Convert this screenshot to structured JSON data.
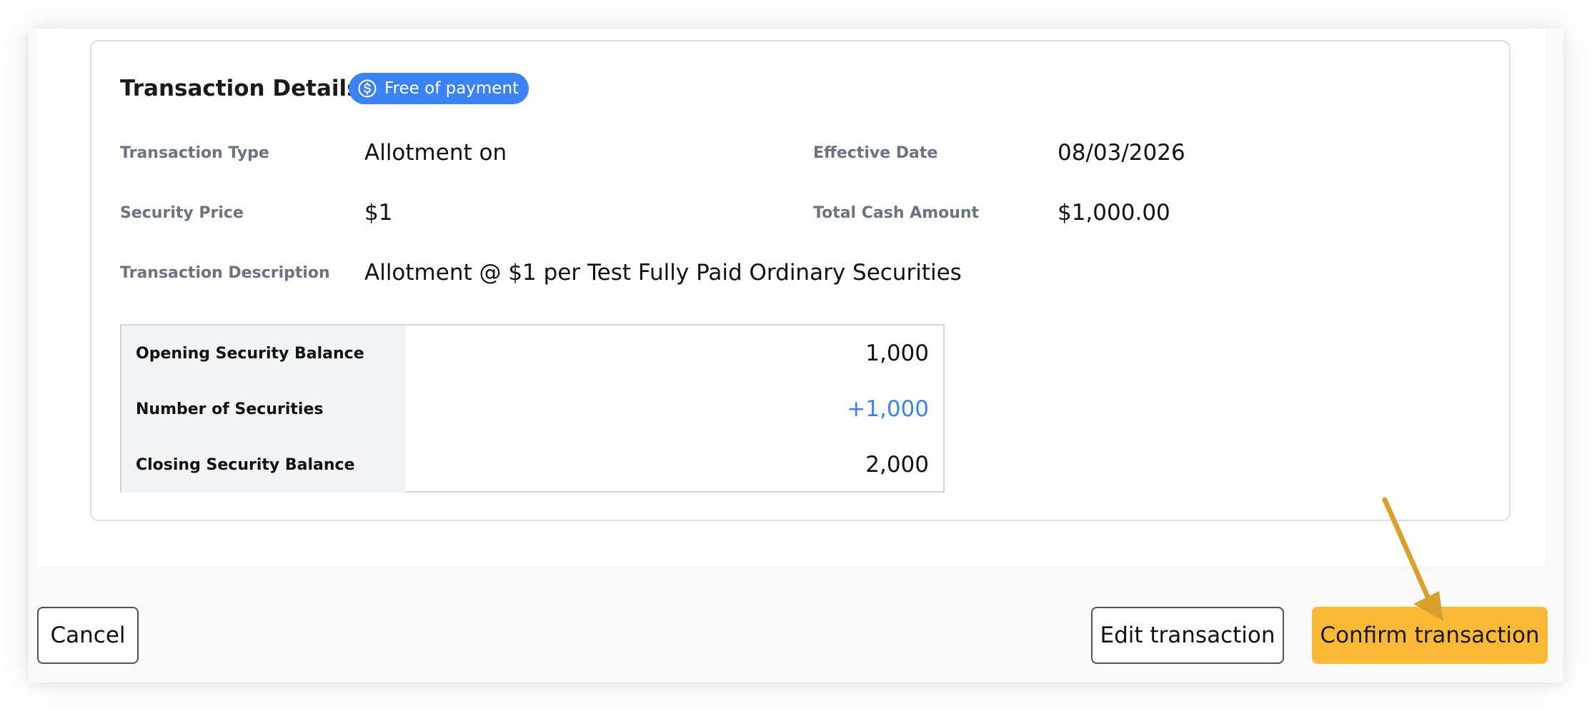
{
  "details": {
    "title": "Transaction Details",
    "badge_label": "Free of payment",
    "badge_icon": "dollar-circle-icon",
    "fields": {
      "transaction_type": {
        "label": "Transaction Type",
        "value": "Allotment on"
      },
      "effective_date": {
        "label": "Effective Date",
        "value": "08/03/2026"
      },
      "security_price": {
        "label": "Security Price",
        "value": "$1"
      },
      "total_cash_amount": {
        "label": "Total Cash Amount",
        "value": "$1,000.00"
      },
      "transaction_description": {
        "label": "Transaction Description",
        "value": "Allotment @ $1 per Test Fully Paid Ordinary Securities"
      }
    },
    "balances": [
      {
        "label": "Opening Security Balance",
        "value": "1,000"
      },
      {
        "label": "Number of Securities",
        "value": "+1,000"
      },
      {
        "label": "Closing Security Balance",
        "value": "2,000"
      }
    ]
  },
  "actions": {
    "cancel_label": "Cancel",
    "edit_label": "Edit transaction",
    "confirm_label": "Confirm transaction"
  },
  "colors": {
    "badge": "#3b82f6",
    "positive": "#3b82f6",
    "primary_button": "#fbb935",
    "annotation_arrow": "#d9a02c"
  }
}
